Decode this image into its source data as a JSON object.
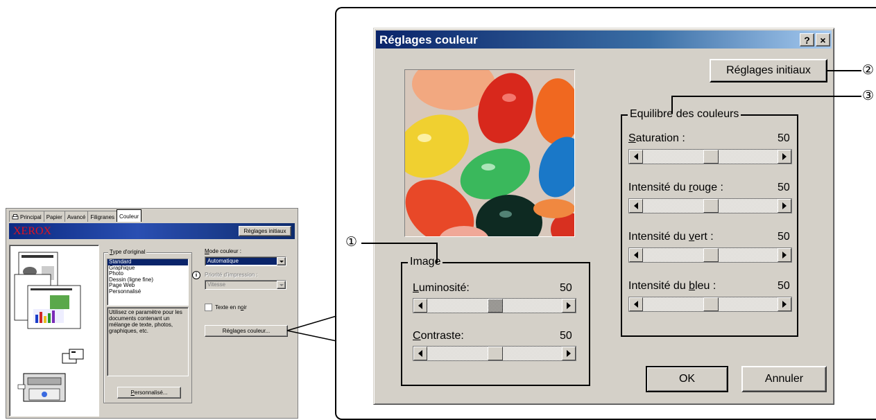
{
  "small_dialog": {
    "tabs": [
      "Principal",
      "Papier",
      "Avancé",
      "Filigranes",
      "Couleur"
    ],
    "brand": "XEROX",
    "reset_button": "Réglages initiaux",
    "original_type": {
      "label_u": "T",
      "label_rest": "ype d'original",
      "items": [
        "Standard",
        "Graphique",
        "Photo",
        "Dessin (ligne fine)",
        "Page Web",
        "Personnalisé"
      ],
      "selected": 0,
      "description": "Utilisez ce paramètre pour les documents contenant un mélange de texte, photos, graphiques, etc."
    },
    "custom_button_u": "P",
    "custom_button_rest": "ersonnalisé...",
    "color_mode": {
      "label_u": "M",
      "label_rest": "ode couleur :",
      "value": "Automatique"
    },
    "print_priority": {
      "label": "Priorité d'impression :",
      "value": "Vitesse"
    },
    "black_text": {
      "label_pre": "Texte en n",
      "label_u": "o",
      "label_post": "ir"
    },
    "color_settings_button_pre": "Ré",
    "color_settings_button_u": "g",
    "color_settings_button_post": "lages couleur..."
  },
  "dialog": {
    "title": "Réglages couleur",
    "help_btn": "?",
    "close_btn": "×",
    "reset_button_pre": "Ré",
    "reset_button_u": "g",
    "reset_button_post": "lages initiaux",
    "image_group": "Image",
    "brightness": {
      "u": "L",
      "rest": "uminosité:",
      "value": "50",
      "level": 0.5
    },
    "contrast": {
      "u": "C",
      "rest": "ontraste:",
      "value": "50",
      "level": 0.5
    },
    "balance_group": "Equilibre des couleurs",
    "saturation": {
      "pre": "",
      "u": "S",
      "rest": "aturation :",
      "value": "50",
      "level": 0.5
    },
    "red": {
      "pre": "Intensité du ",
      "u": "r",
      "rest": "ouge :",
      "value": "50",
      "level": 0.5
    },
    "green": {
      "pre": "Intensité du ",
      "u": "v",
      "rest": "ert :",
      "value": "50",
      "level": 0.5
    },
    "blue": {
      "pre": "Intensité du ",
      "u": "b",
      "rest": "leu :",
      "value": "50",
      "level": 0.5
    },
    "ok": "OK",
    "cancel": "Annuler"
  },
  "callouts": [
    "①",
    "②",
    "③"
  ]
}
